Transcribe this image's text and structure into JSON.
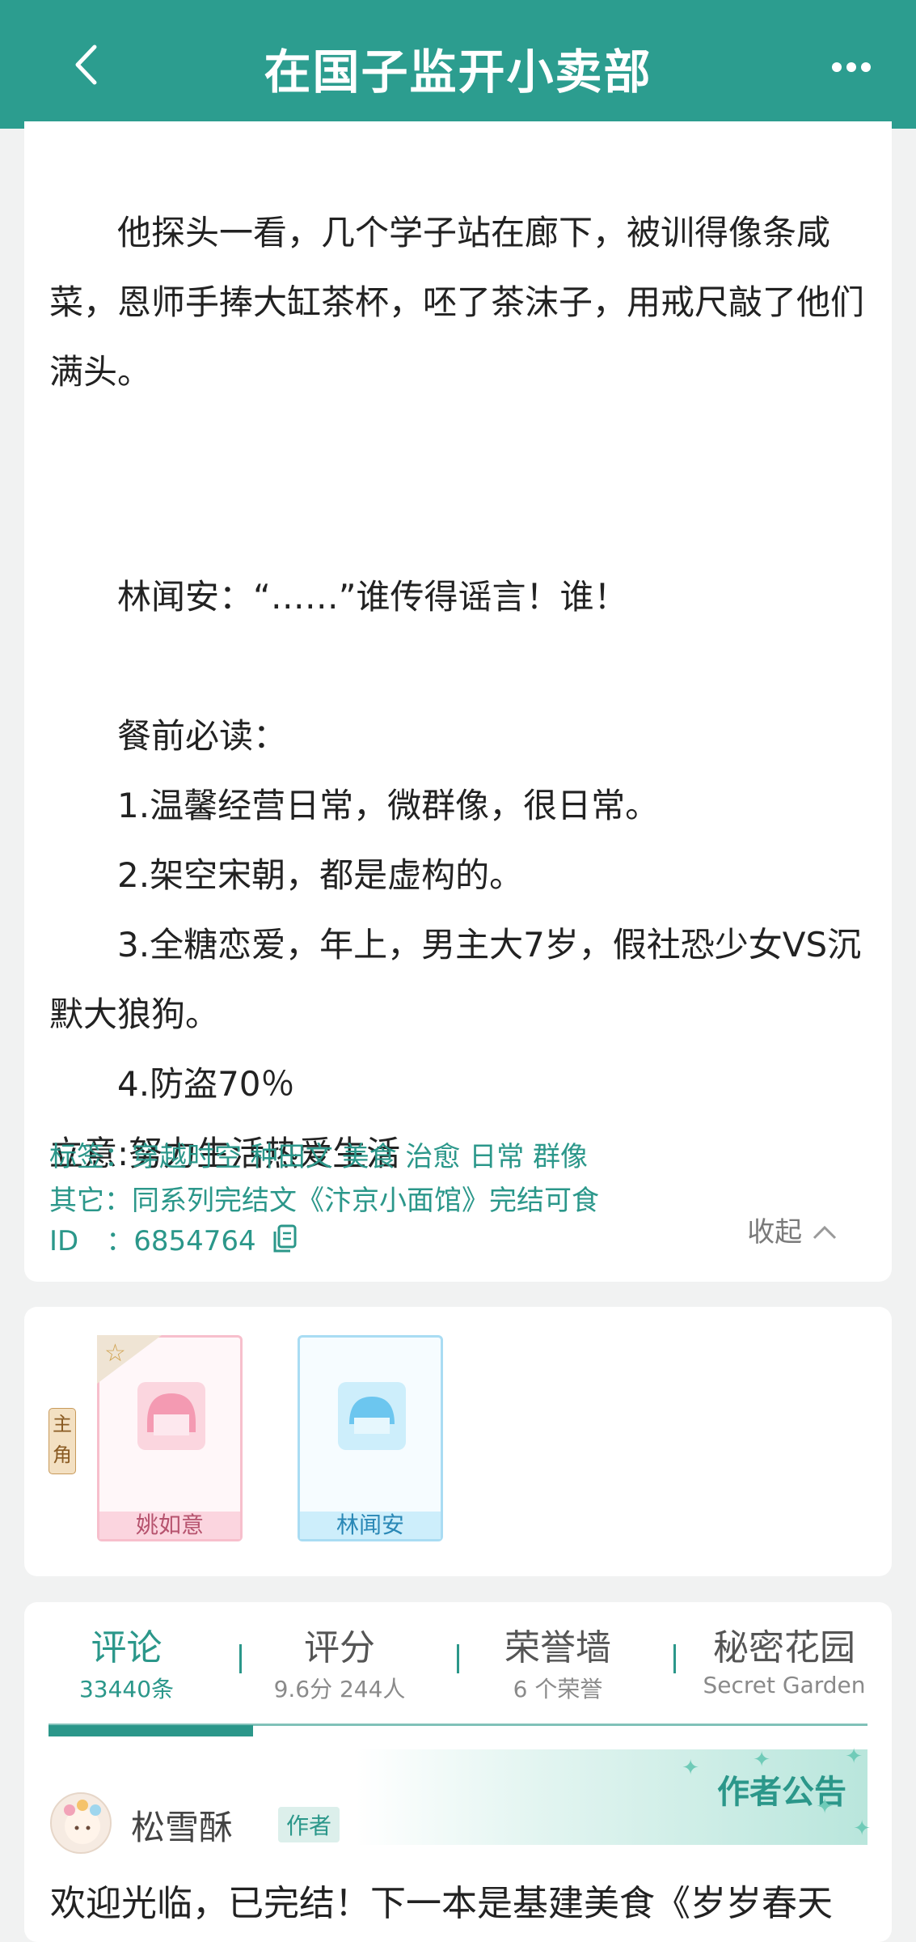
{
  "header": {
    "title": "在国子监开小卖部"
  },
  "intro": {
    "paragraphs": [
      "　　他探头一看，几个学子站在廊下，被训得像条咸菜，恩师手捧大缸茶杯，呸了茶沫子，用戒尺敲了他们满头。",
      "　　林闻安：“……”谁传得谣言！谁！",
      "　　餐前必读：",
      "　　1.温馨经营日常，微群像，很日常。",
      "　　2.架空宋朝，都是虚构的。",
      "　　3.全糖恋爱，年上，男主大7岁，假社恐少女VS沉默大狼狗。",
      "　　4.防盗70％",
      "立意:努力生活热爱生活"
    ],
    "fold_label": "收起",
    "tags_label": "标签：",
    "tags": "穿越时空 种田文 美食 治愈 日常 群像",
    "other_label": "其它：",
    "other": "同系列完结文《汴京小面馆》完结可食",
    "id_label": "ID　：",
    "id": "6854764"
  },
  "roles": {
    "lead_label": "主角",
    "characters": [
      {
        "name": "姚如意",
        "color": "pink"
      },
      {
        "name": "林闻安",
        "color": "blue"
      }
    ]
  },
  "comments": {
    "tabs": [
      {
        "title": "评论",
        "sub": "33440条"
      },
      {
        "title": "评分",
        "sub": "9.6分 244人"
      },
      {
        "title": "荣誉墙",
        "sub": "6 个荣誉"
      },
      {
        "title": "秘密花园",
        "sub": "Secret Garden"
      }
    ],
    "banner": "作者公告",
    "author": {
      "name": "松雪酥",
      "badge": "作者"
    },
    "text": "欢迎光临，已完结！下一本是基建美食《岁岁春天"
  },
  "colors": {
    "accent": "#2c9d8f",
    "pink": "#f7bfcc",
    "blue": "#a9dcf3"
  }
}
